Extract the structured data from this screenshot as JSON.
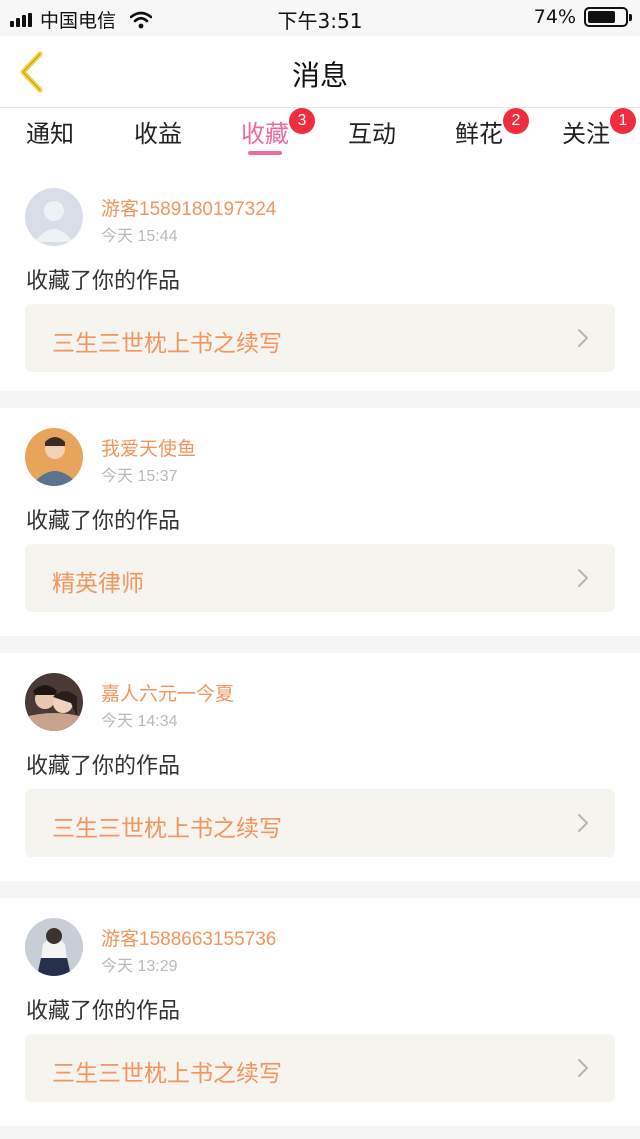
{
  "status_bar": {
    "carrier": "中国电信",
    "time": "下午3:51",
    "battery_text": "74%",
    "battery_level": 0.74
  },
  "header": {
    "title": "消息"
  },
  "tabs": [
    {
      "label": "通知",
      "badge": ""
    },
    {
      "label": "收益",
      "badge": ""
    },
    {
      "label": "收藏",
      "badge": "3"
    },
    {
      "label": "互动",
      "badge": ""
    },
    {
      "label": "鲜花",
      "badge": "2"
    },
    {
      "label": "关注",
      "badge": "1"
    }
  ],
  "active_tab": "收藏",
  "colors": {
    "accent_pink": "#f06aa0",
    "badge_red": "#ef2d3f",
    "name_orange": "#f2955e",
    "work_bg": "#f6f4ee"
  },
  "notifications": [
    {
      "username": "游客1589180197324",
      "time": "今天 15:44",
      "action": "收藏了你的作品",
      "work_title": "三生三世枕上书之续写"
    },
    {
      "username": "我爱天使鱼",
      "time": "今天 15:37",
      "action": "收藏了你的作品",
      "work_title": "精英律师"
    },
    {
      "username": "嘉人六元一今夏",
      "time": "今天 14:34",
      "action": "收藏了你的作品",
      "work_title": "三生三世枕上书之续写"
    },
    {
      "username": "游客1588663155736",
      "time": "今天 13:29",
      "action": "收藏了你的作品",
      "work_title": "三生三世枕上书之续写"
    }
  ]
}
